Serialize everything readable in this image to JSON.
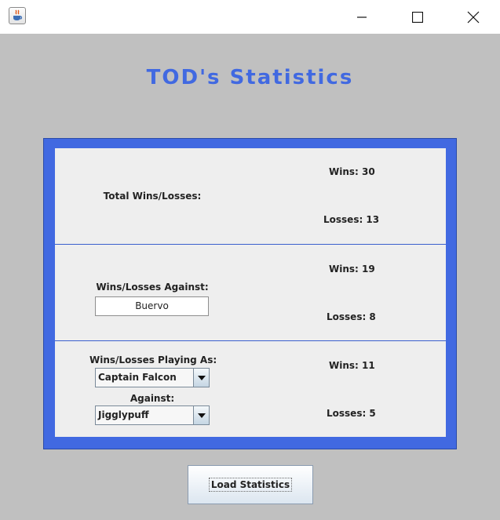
{
  "window": {
    "icons": {
      "app": "java-cup-icon",
      "minimize": "minimize-icon",
      "maximize": "maximize-icon",
      "close": "close-icon"
    }
  },
  "heading": "TOD's Statistics",
  "total": {
    "label": "Total Wins/Losses:",
    "wins": "Wins: 30",
    "losses": "Losses: 13"
  },
  "against": {
    "label": "Wins/Losses Against:",
    "opponent_value": "Buervo",
    "wins": "Wins: 19",
    "losses": "Losses: 8"
  },
  "playing_as": {
    "label": "Wins/Losses Playing As:",
    "character_value": "Captain Falcon",
    "against_label": "Against:",
    "opponent_character_value": "Jigglypuff",
    "wins": "Wins: 11",
    "losses": "Losses: 5"
  },
  "load_button": "Load Statistics",
  "colors": {
    "accent": "#4169e1",
    "background": "#c0c0c0",
    "panel": "#eeeeee"
  }
}
